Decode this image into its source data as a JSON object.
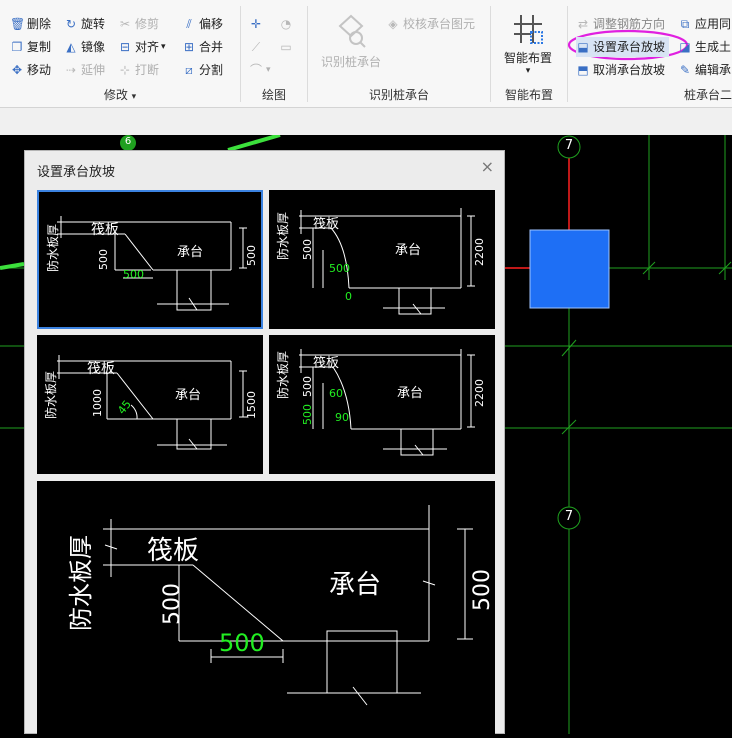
{
  "ribbon": {
    "modify": {
      "delete": "删除",
      "rotate": "旋转",
      "trim": "修剪",
      "offset": "偏移",
      "copy": "复制",
      "mirror": "镜像",
      "align": "对齐",
      "merge": "合并",
      "move": "移动",
      "extend": "延伸",
      "break": "打断",
      "split": "分割",
      "label": "修改",
      "label_arrow": "▾"
    },
    "draw": {
      "label": "绘图"
    },
    "recognize": {
      "recognize_pile_cap": "识别桩承台",
      "check_pile_cap": "校核承台图元",
      "label": "识别桩承台"
    },
    "smart": {
      "smart_layout": "智能布置",
      "label": "智能布置",
      "arrow": "▾"
    },
    "pilecap": {
      "adjust_rebar": "调整钢筋方向",
      "apply_same": "应用同",
      "set_slope": "设置承台放坡",
      "generate": "生成土",
      "cancel_slope": "取消承台放坡",
      "edit": "编辑承",
      "label": "桩承台二"
    }
  },
  "canvas": {
    "axis_top": "7",
    "axis_bottom": "7",
    "axis_left": "6"
  },
  "colors": {
    "highlight": "#e020e0",
    "selected_border": "#3b82e0",
    "blue_cap": "#1e6ff5",
    "grid_green": "#1fa01f",
    "red_axis": "#ff2020",
    "dim_green": "#22ee22"
  },
  "dialog": {
    "title": "设置承台放坡",
    "close": "×",
    "options": [
      {
        "waterproof": "防水板厚",
        "raft": "筏板",
        "cap": "承台",
        "d1": "500",
        "d2": "500",
        "d3": "500"
      },
      {
        "waterproof": "防水板厚",
        "raft": "筏板",
        "cap": "承台",
        "d1": "500",
        "d2": "500",
        "d3": "0",
        "d4": "2200"
      },
      {
        "waterproof": "防水板厚",
        "raft": "筏板",
        "cap": "承台",
        "d1": "1000",
        "d2": "45",
        "d3": "1500"
      },
      {
        "waterproof": "防水板厚",
        "raft": "筏板",
        "cap": "承台",
        "d1": "500",
        "d2": "500",
        "d3": "60",
        "d4": "90",
        "d5": "2200"
      }
    ],
    "preview": {
      "waterproof": "防水板厚",
      "raft": "筏板",
      "cap": "承台",
      "d1": "500",
      "d2": "500",
      "d3": "500"
    }
  }
}
